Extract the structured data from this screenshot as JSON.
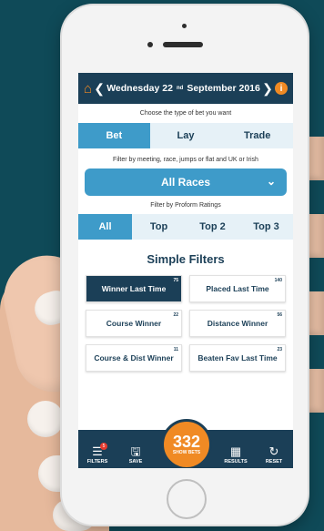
{
  "header": {
    "date_prefix": "Wednesday 22",
    "date_suffix": "nd",
    "date_rest": "September 2016"
  },
  "bet_type": {
    "caption": "Choose the type of bet you want",
    "options": [
      "Bet",
      "Lay",
      "Trade"
    ],
    "selected": "Bet"
  },
  "race_filter": {
    "caption": "Filter by meeting, race, jumps or flat and UK or Irish",
    "value": "All Races"
  },
  "proform": {
    "caption": "Filter by Proform Ratings",
    "options": [
      "All",
      "Top",
      "Top 2",
      "Top 3"
    ],
    "selected": "All"
  },
  "simple_filters": {
    "title": "Simple Filters",
    "items": [
      {
        "label": "Winner Last Time",
        "count": "75",
        "active": true
      },
      {
        "label": "Placed Last Time",
        "count": "140",
        "active": false
      },
      {
        "label": "Course Winner",
        "count": "22",
        "active": false
      },
      {
        "label": "Distance Winner",
        "count": "56",
        "active": false
      },
      {
        "label": "Course & Dist Winner",
        "count": "11",
        "active": false
      },
      {
        "label": "Beaten Fav Last Time",
        "count": "23",
        "active": false
      }
    ]
  },
  "bottom_bar": {
    "filters_label": "FILTERS",
    "filters_badge": "5",
    "save_label": "SAVE",
    "show_bets_count": "332",
    "show_bets_label": "SHOW BETS",
    "results_label": "RESULTS",
    "reset_label": "RESET"
  },
  "colors": {
    "background": "#0f4a58",
    "header": "#1b3f57",
    "accent_blue": "#3e9bc9",
    "accent_orange": "#f08a24"
  }
}
